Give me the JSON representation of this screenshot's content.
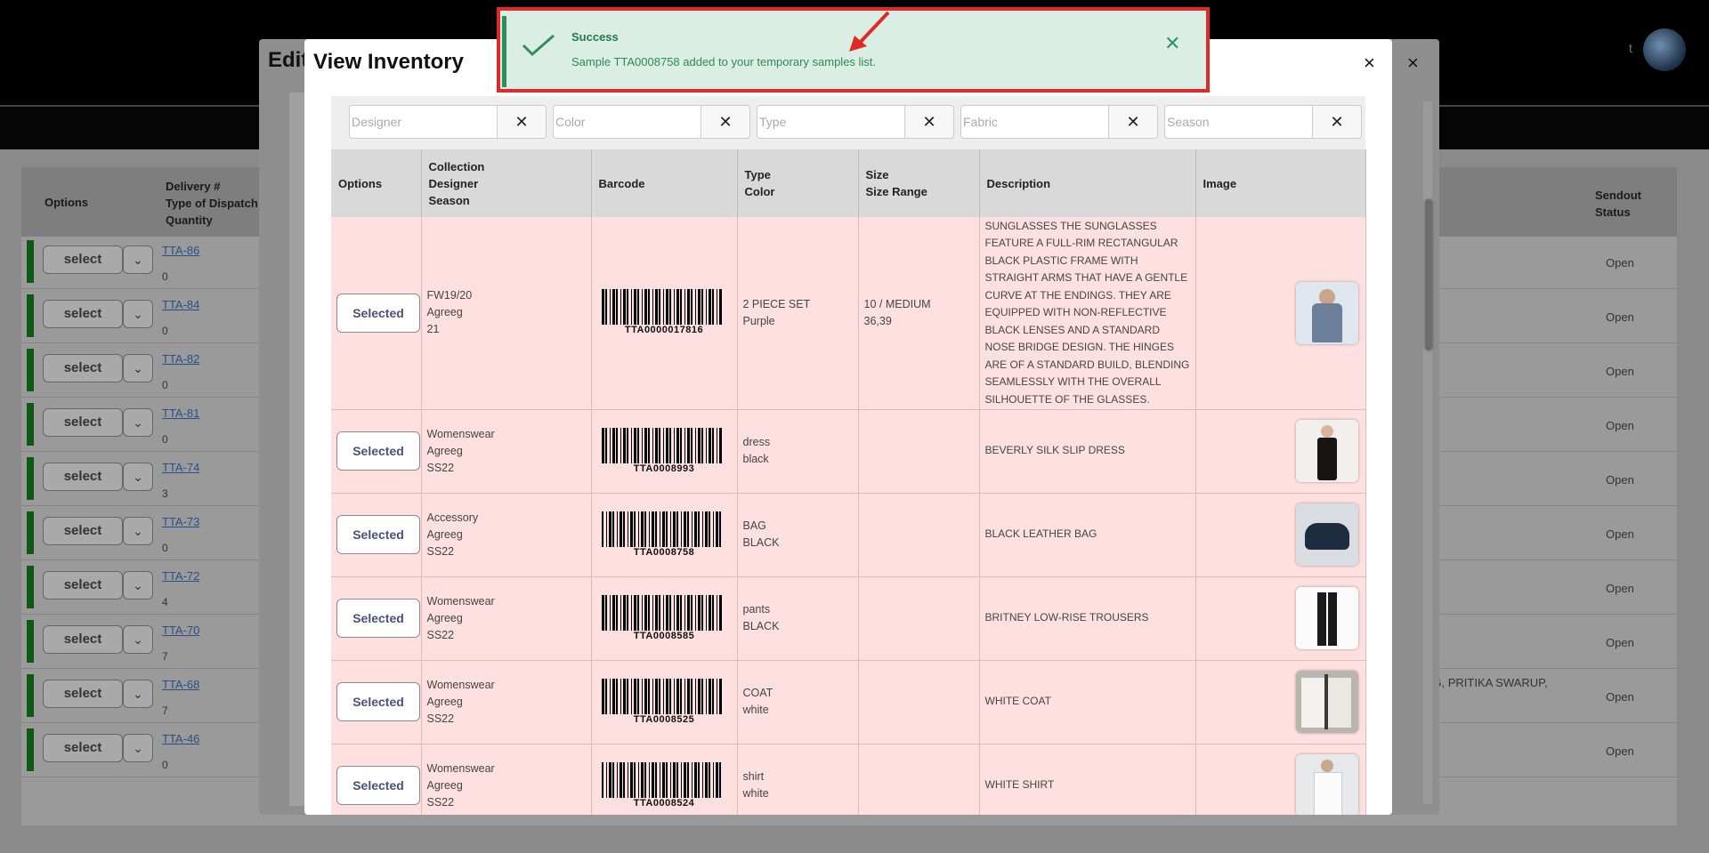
{
  "background": {
    "table_headers": {
      "options": "Options",
      "delivery": [
        "Delivery #",
        "Type of Dispatch",
        "Quantity"
      ],
      "sendout_status": [
        "Sendout",
        "Status"
      ]
    },
    "rows": [
      {
        "select": "select",
        "link": "TTA-86",
        "qty": "0",
        "status": "Open"
      },
      {
        "select": "select",
        "link": "TTA-84",
        "qty": "0",
        "status": "Open"
      },
      {
        "select": "select",
        "link": "TTA-82",
        "qty": "0",
        "status": "Open"
      },
      {
        "select": "select",
        "link": "TTA-81",
        "qty": "0",
        "status": "Open"
      },
      {
        "select": "select",
        "link": "TTA-74",
        "qty": "3",
        "status": "Open"
      },
      {
        "select": "select",
        "link": "TTA-73",
        "qty": "0",
        "status": "Open"
      },
      {
        "select": "select",
        "link": "TTA-72",
        "qty": "4",
        "status": "Open"
      },
      {
        "select": "select",
        "link": "TTA-70",
        "qty": "7",
        "status": "Open"
      },
      {
        "select": "select",
        "link": "TTA-68",
        "qty": "7",
        "status": "Open"
      },
      {
        "select": "select",
        "link": "TTA-46",
        "qty": "0",
        "status": "Open"
      }
    ],
    "side_text": "NG, PRITIKA SWARUP,"
  },
  "edit_modal": {
    "title": "Edit",
    "close": "×"
  },
  "inventory_modal": {
    "title": "View Inventory",
    "close": "×",
    "filters": [
      {
        "placeholder": "Designer",
        "clear": "✕"
      },
      {
        "placeholder": "Color",
        "clear": "✕"
      },
      {
        "placeholder": "Type",
        "clear": "✕"
      },
      {
        "placeholder": "Fabric",
        "clear": "✕"
      },
      {
        "placeholder": "Season",
        "clear": "✕"
      }
    ],
    "columns": {
      "options": "Options",
      "collection": [
        "Collection",
        "Designer",
        "Season"
      ],
      "barcode": "Barcode",
      "type": [
        "Type",
        "Color"
      ],
      "size": [
        "Size",
        "Size Range"
      ],
      "description": "Description",
      "image": "Image"
    },
    "rows": [
      {
        "button": "Selected",
        "collection": "FW19/20",
        "designer": "Agreeg",
        "season": "21",
        "barcode": "TTA0000017816",
        "type": "2 PIECE SET",
        "color": "Purple",
        "size": "10 / MEDIUM",
        "size_range": "36,39",
        "description": "SUNGLASSES THE SUNGLASSES FEATURE A FULL-RIM RECTANGULAR BLACK PLASTIC FRAME WITH STRAIGHT ARMS THAT HAVE A GENTLE CURVE AT THE ENDINGS. THEY ARE EQUIPPED WITH NON-REFLECTIVE BLACK LENSES AND A STANDARD NOSE BRIDGE DESIGN. THE HINGES ARE OF A STANDARD BUILD, BLENDING SEAMLESSLY WITH THE OVERALL SILHOUETTE OF THE GLASSES.",
        "image": "suit-photo"
      },
      {
        "button": "Selected",
        "collection": "Womenswear",
        "designer": "Agreeg",
        "season": "SS22",
        "barcode": "TTA0008993",
        "type": "dress",
        "color": "black",
        "size": "",
        "size_range": "",
        "description": "BEVERLY SILK SLIP DRESS",
        "image": "dress-photo"
      },
      {
        "button": "Selected",
        "collection": "Accessory",
        "designer": "Agreeg",
        "season": "SS22",
        "barcode": "TTA0008758",
        "type": "BAG",
        "color": "BLACK",
        "size": "",
        "size_range": "",
        "description": "BLACK LEATHER BAG",
        "image": "bag-photo"
      },
      {
        "button": "Selected",
        "collection": "Womenswear",
        "designer": "Agreeg",
        "season": "SS22",
        "barcode": "TTA0008585",
        "type": "pants",
        "color": "BLACK",
        "size": "",
        "size_range": "",
        "description": "BRITNEY LOW-RISE TROUSERS",
        "image": "trousers-photo"
      },
      {
        "button": "Selected",
        "collection": "Womenswear",
        "designer": "Agreeg",
        "season": "SS22",
        "barcode": "TTA0008525",
        "type": "COAT",
        "color": "white",
        "size": "",
        "size_range": "",
        "description": "WHITE COAT",
        "image": "coat-photo"
      },
      {
        "button": "Selected",
        "collection": "Womenswear",
        "designer": "Agreeg",
        "season": "SS22",
        "barcode": "TTA0008524",
        "type": "shirt",
        "color": "white",
        "size": "",
        "size_range": "",
        "description": "WHITE SHIRT",
        "image": "shirt-photo"
      }
    ]
  },
  "toast": {
    "title": "Success",
    "message": "Sample TTA0008758 added to your temporary samples list.",
    "close": "✕",
    "icon": "check-icon",
    "accent": "#2f8e5c",
    "highlight": "#e02a2a"
  }
}
